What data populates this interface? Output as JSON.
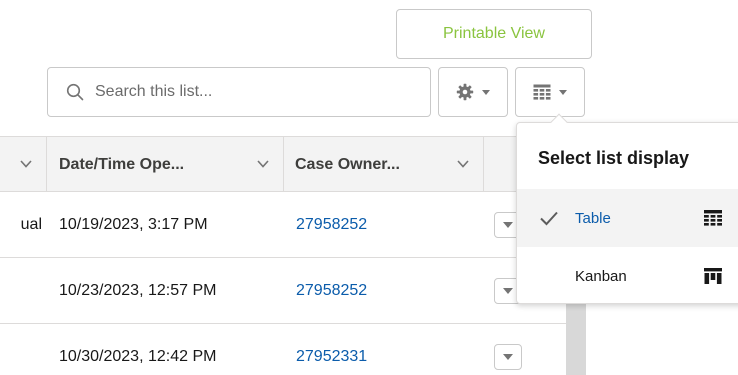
{
  "toolbar": {
    "printable_view_label": "Printable View",
    "search_placeholder": "Search this list..."
  },
  "table": {
    "columns": [
      {
        "label": ""
      },
      {
        "label": "Date/Time Ope..."
      },
      {
        "label": "Case Owner..."
      },
      {
        "label": ""
      }
    ],
    "rows": [
      {
        "cut_cell": "ual",
        "date_time_opened": "10/19/2023, 3:17 PM",
        "case_owner": "27958252"
      },
      {
        "cut_cell": "",
        "date_time_opened": "10/23/2023, 12:57 PM",
        "case_owner": "27958252"
      },
      {
        "cut_cell": "",
        "date_time_opened": "10/30/2023, 12:42 PM",
        "case_owner": "27952331"
      }
    ]
  },
  "list_display_menu": {
    "title": "Select list display",
    "items": [
      {
        "label": "Table",
        "icon": "table-icon",
        "selected": true
      },
      {
        "label": "Kanban",
        "icon": "kanban-icon",
        "selected": false
      }
    ]
  },
  "colors": {
    "accent_green": "#8ac43f",
    "link_blue": "#0b5cab",
    "border": "#c9c9c9",
    "header_bg": "#f3f3f3"
  }
}
